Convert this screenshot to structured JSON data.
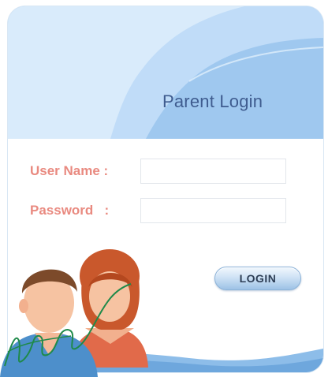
{
  "login_card": {
    "title": "Parent Login",
    "username_label": "User Name :",
    "username_value": "",
    "password_label": "Password   :",
    "password_value": "",
    "login_button_label": "LOGIN"
  },
  "colors": {
    "header_blue": "#7fb3e6",
    "title_text": "#3f5c8f",
    "label_text": "#e98a80",
    "button_text": "#2d3e55"
  },
  "icons": {
    "illustration": "parents-icon",
    "signature": "signature-scribble"
  }
}
